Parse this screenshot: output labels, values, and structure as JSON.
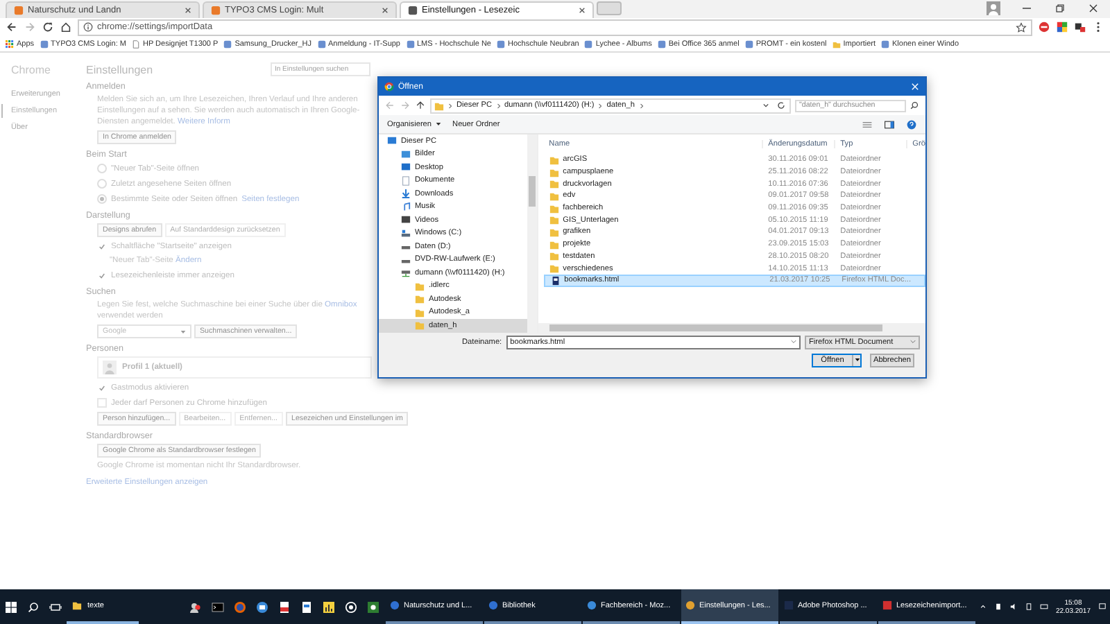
{
  "browser": {
    "tabs": [
      {
        "title": "Naturschutz und Landn",
        "selected": false
      },
      {
        "title": "TYPO3 CMS Login: Mult",
        "selected": false
      },
      {
        "title": "Einstellungen - Lesezeic",
        "selected": true
      }
    ],
    "address": "chrome://settings/importData",
    "bookmarks": [
      {
        "label": "Apps",
        "kind": "apps"
      },
      {
        "label": "TYPO3 CMS Login: M",
        "kind": "site"
      },
      {
        "label": "HP Designjet T1300 P",
        "kind": "page"
      },
      {
        "label": "Samsung_Drucker_HJ",
        "kind": "site"
      },
      {
        "label": "Anmeldung - IT-Supp",
        "kind": "site"
      },
      {
        "label": "LMS - Hochschule Ne",
        "kind": "site"
      },
      {
        "label": "Hochschule Neubran",
        "kind": "site"
      },
      {
        "label": "Lychee - Albums",
        "kind": "site"
      },
      {
        "label": "Bei Office 365 anmel",
        "kind": "site"
      },
      {
        "label": "PROMT - ein kostenl",
        "kind": "site"
      },
      {
        "label": "Importiert",
        "kind": "folder"
      },
      {
        "label": "Klonen einer Windo",
        "kind": "site"
      }
    ]
  },
  "settings": {
    "sidebar": {
      "title": "Chrome",
      "items": [
        {
          "label": "Erweiterungen",
          "selected": false
        },
        {
          "label": "Einstellungen",
          "selected": true
        },
        {
          "label": "Über",
          "selected": false
        }
      ]
    },
    "title": "Einstellungen",
    "search": {
      "placeholder": "In Einstellungen suchen"
    },
    "sections": [
      {
        "title": "Anmelden",
        "rows": [
          {
            "kind": "paragraph",
            "text": "Melden Sie sich an, um Ihre Lesezeichen, Ihren Verlauf und Ihre anderen Einstellungen auf a sehen. Sie werden auch automatisch in Ihren Google-Diensten angemeldet. ",
            "link": "Weitere Inform"
          },
          {
            "kind": "buttons",
            "buttons": [
              {
                "label": "In Chrome anmelden",
                "disabled": false
              }
            ]
          }
        ]
      },
      {
        "title": "Beim Start",
        "rows": [
          {
            "kind": "radio",
            "label": "\"Neuer Tab\"-Seite öffnen",
            "selected": false
          },
          {
            "kind": "radio",
            "label": "Zuletzt angesehene Seiten öffnen",
            "selected": false
          },
          {
            "kind": "radio",
            "label": "Bestimmte Seite oder Seiten öffnen",
            "selected": true,
            "link": "Seiten festlegen"
          }
        ]
      },
      {
        "title": "Darstellung",
        "rows": [
          {
            "kind": "buttons",
            "buttons": [
              {
                "label": "Designs abrufen",
                "disabled": false
              },
              {
                "label": "Auf Standarddesign zurücksetzen",
                "disabled": true
              }
            ]
          },
          {
            "kind": "checkbox",
            "label": "Schaltfläche \"Startseite\" anzeigen",
            "checked": true
          },
          {
            "kind": "subline",
            "text": "\"Neuer Tab\"-Seite ",
            "link": "Ändern"
          },
          {
            "kind": "checkbox",
            "label": "Lesezeichenleiste immer anzeigen",
            "checked": true
          }
        ]
      },
      {
        "title": "Suchen",
        "rows": [
          {
            "kind": "paragraph",
            "text": "Legen Sie fest, welche Suchmaschine bei einer Suche über die ",
            "link": "Omnibox",
            "after": " verwendet werden"
          },
          {
            "kind": "select",
            "value": "Google",
            "button": "Suchmaschinen verwalten..."
          }
        ]
      },
      {
        "title": "Personen",
        "rows": [
          {
            "kind": "profile",
            "label": "Profil 1 (aktuell)"
          },
          {
            "kind": "checkbox",
            "label": "Gastmodus aktivieren",
            "checked": true
          },
          {
            "kind": "checkbox",
            "label": "Jeder darf Personen zu Chrome hinzufügen",
            "checked": false
          },
          {
            "kind": "buttons",
            "buttons": [
              {
                "label": "Person hinzufügen...",
                "disabled": false
              },
              {
                "label": "Bearbeiten...",
                "disabled": true
              },
              {
                "label": "Entfernen...",
                "disabled": true
              },
              {
                "label": "Lesezeichen und Einstellungen im",
                "disabled": false
              }
            ]
          }
        ]
      },
      {
        "title": "Standardbrowser",
        "rows": [
          {
            "kind": "buttons",
            "buttons": [
              {
                "label": "Google Chrome als Standardbrowser festlegen",
                "disabled": false
              }
            ]
          },
          {
            "kind": "paragraph",
            "text": "Google Chrome ist momentan nicht Ihr Standardbrowser."
          }
        ]
      }
    ],
    "advanced_link": "Erweiterte Einstellungen anzeigen"
  },
  "dialog": {
    "title": "Öffnen",
    "breadcrumb": [
      "Dieser PC",
      "dumann (\\\\vf0111420) (H:)",
      "daten_h"
    ],
    "search": {
      "placeholder": "\"daten_h\" durchsuchen"
    },
    "toolbar": {
      "organize": "Organisieren",
      "new_folder": "Neuer Ordner"
    },
    "tree": [
      {
        "label": "Dieser PC",
        "kind": "computer",
        "selected": false,
        "children": [
          {
            "label": "Bilder",
            "kind": "pictures",
            "selected": false
          },
          {
            "label": "Desktop",
            "kind": "desktop",
            "selected": false
          },
          {
            "label": "Dokumente",
            "kind": "documents",
            "selected": false
          },
          {
            "label": "Downloads",
            "kind": "downloads",
            "selected": false
          },
          {
            "label": "Musik",
            "kind": "music",
            "selected": false
          },
          {
            "label": "Videos",
            "kind": "videos",
            "selected": false
          },
          {
            "label": "Windows (C:)",
            "kind": "system_drive",
            "selected": false
          },
          {
            "label": "Daten (D:)",
            "kind": "drive",
            "selected": false
          },
          {
            "label": "DVD-RW-Laufwerk (E:)",
            "kind": "drive",
            "selected": false
          },
          {
            "label": "dumann (\\\\vf0111420) (H:)",
            "kind": "network_drive",
            "selected": false,
            "children": [
              {
                "label": ".idlerc",
                "kind": "folder",
                "selected": false
              },
              {
                "label": "Autodesk",
                "kind": "folder",
                "selected": false
              },
              {
                "label": "Autodesk_a",
                "kind": "folder",
                "selected": false
              },
              {
                "label": "daten_h",
                "kind": "folder",
                "selected": true
              }
            ]
          }
        ]
      }
    ],
    "columns": [
      "Name",
      "Änderungsdatum",
      "Typ",
      "Grö"
    ],
    "files": [
      {
        "name": "arcGIS",
        "date": "30.11.2016 09:01",
        "type": "Dateiordner",
        "kind": "folder",
        "selected": false
      },
      {
        "name": "campusplaene",
        "date": "25.11.2016 08:22",
        "type": "Dateiordner",
        "kind": "folder",
        "selected": false
      },
      {
        "name": "druckvorlagen",
        "date": "10.11.2016 07:36",
        "type": "Dateiordner",
        "kind": "folder",
        "selected": false
      },
      {
        "name": "edv",
        "date": "09.01.2017 09:58",
        "type": "Dateiordner",
        "kind": "folder",
        "selected": false
      },
      {
        "name": "fachbereich",
        "date": "09.11.2016 09:35",
        "type": "Dateiordner",
        "kind": "folder",
        "selected": false
      },
      {
        "name": "GIS_Unterlagen",
        "date": "05.10.2015 11:19",
        "type": "Dateiordner",
        "kind": "folder",
        "selected": false
      },
      {
        "name": "grafiken",
        "date": "04.01.2017 09:13",
        "type": "Dateiordner",
        "kind": "folder",
        "selected": false
      },
      {
        "name": "projekte",
        "date": "23.09.2015 15:03",
        "type": "Dateiordner",
        "kind": "folder",
        "selected": false
      },
      {
        "name": "testdaten",
        "date": "28.10.2015 08:20",
        "type": "Dateiordner",
        "kind": "folder",
        "selected": false
      },
      {
        "name": "verschiedenes",
        "date": "14.10.2015 11:13",
        "type": "Dateiordner",
        "kind": "folder",
        "selected": false
      },
      {
        "name": "bookmarks.html",
        "date": "21.03.2017 10:25",
        "type": "Firefox HTML Doc...",
        "kind": "file",
        "selected": true
      }
    ],
    "filename_label": "Dateiname:",
    "filename": "bookmarks.html",
    "filter": "Firefox HTML Document",
    "buttons": [
      {
        "label": "Öffnen",
        "kind": "split"
      },
      {
        "label": "Abbrechen",
        "kind": "plain"
      }
    ]
  },
  "taskbar": {
    "folder": {
      "label": "texte"
    },
    "windows": [
      {
        "label": "Naturschutz und L...",
        "kind": "browser",
        "selected": false
      },
      {
        "label": "Bibliothek",
        "kind": "browser",
        "selected": false
      },
      {
        "label": "Fachbereich - Moz...",
        "kind": "mail",
        "selected": false
      },
      {
        "label": "Einstellungen - Les...",
        "kind": "chrome",
        "selected": true
      },
      {
        "label": "Adobe Photoshop ...",
        "kind": "photoshop",
        "selected": false
      },
      {
        "label": "Lesezeichenimport...",
        "kind": "pdf",
        "selected": false
      }
    ],
    "time": "15:08",
    "date": "22.03.2017"
  }
}
